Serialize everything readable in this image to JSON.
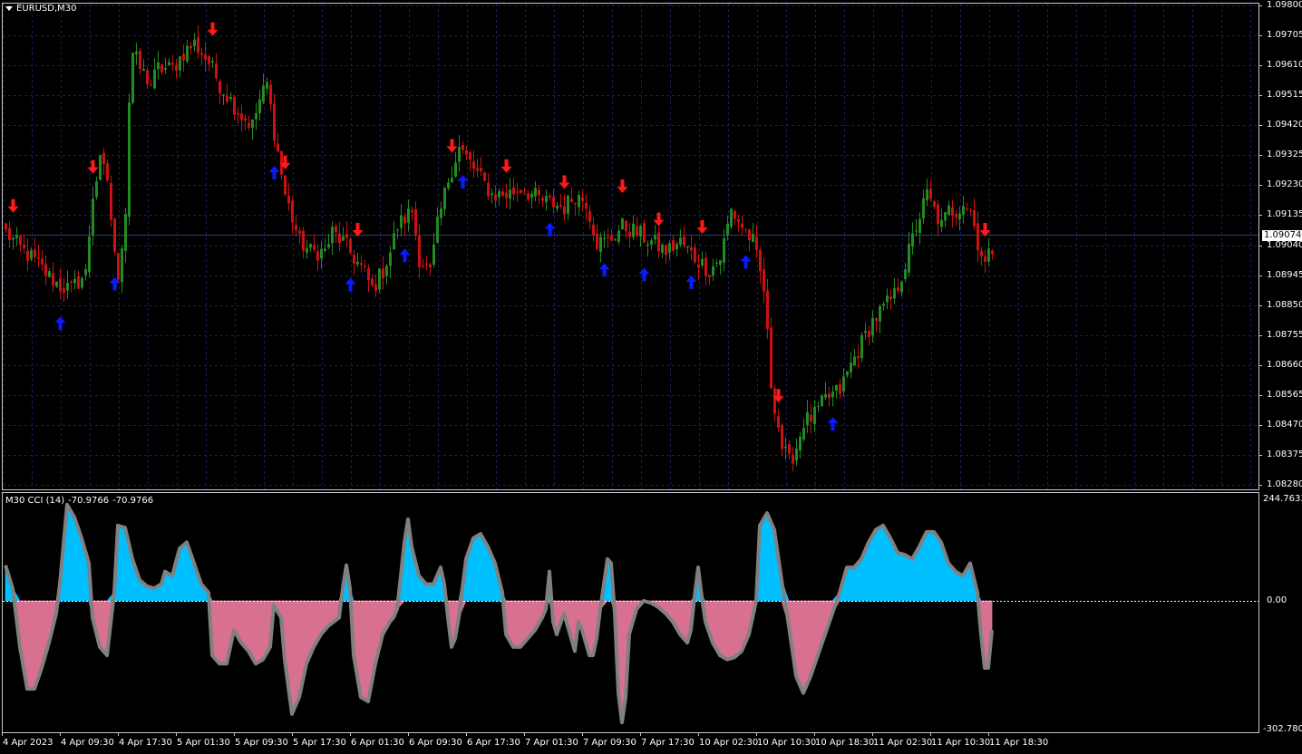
{
  "main_chart": {
    "symbol_timeframe": "EURUSD,M30",
    "price_axis": [
      "1.09800",
      "1.09705",
      "1.09610",
      "1.09515",
      "1.09420",
      "1.09325",
      "1.09230",
      "1.09135",
      "1.09040",
      "1.08945",
      "1.08850",
      "1.08755",
      "1.08660",
      "1.08565",
      "1.08470",
      "1.08375",
      "1.08280"
    ],
    "current_price": "1.09074",
    "colors": {
      "background": "#000000",
      "grid": "#1c1c5a",
      "bull_candle": "#228b22",
      "bear_candle": "#cc1111",
      "buy_arrow": "#0a1aff",
      "sell_arrow": "#ff1a1a",
      "current_price_line": "#2a3a8a"
    }
  },
  "indicator": {
    "name": "M30 CCI (14)",
    "value1": "-70.9766",
    "value2": "-70.9766",
    "axis_top": "244.7633",
    "axis_zero": "0.00",
    "axis_bottom": "-302.7802",
    "colors": {
      "positive_fill": "#00bfff",
      "negative_fill": "#d87090",
      "line": "#808080"
    }
  },
  "time_axis": [
    "4 Apr 2023",
    "4 Apr 09:30",
    "4 Apr 17:30",
    "5 Apr 01:30",
    "5 Apr 09:30",
    "5 Apr 17:30",
    "6 Apr 01:30",
    "6 Apr 09:30",
    "6 Apr 17:30",
    "7 Apr 01:30",
    "7 Apr 09:30",
    "7 Apr 17:30",
    "10 Apr 02:30",
    "10 Apr 10:30",
    "10 Apr 18:30",
    "11 Apr 02:30",
    "11 Apr 10:30",
    "11 Apr 18:30"
  ],
  "chart_data": [
    {
      "type": "candlestick",
      "title": "EURUSD,M30",
      "ylim": [
        1.0828,
        1.098
      ],
      "current_price": 1.09074,
      "close_path": [
        [
          0,
          1.0908
        ],
        [
          4,
          1.0903
        ],
        [
          8,
          1.0899
        ],
        [
          12,
          1.0894
        ],
        [
          15,
          1.0891
        ],
        [
          18,
          1.089
        ],
        [
          22,
          1.0895
        ],
        [
          24,
          1.092
        ],
        [
          26,
          1.093
        ],
        [
          28,
          1.0925
        ],
        [
          30,
          1.09
        ],
        [
          31,
          1.0895
        ],
        [
          33,
          1.0915
        ],
        [
          34,
          1.095
        ],
        [
          35,
          1.0965
        ],
        [
          37,
          1.096
        ],
        [
          40,
          1.0955
        ],
        [
          42,
          1.096
        ],
        [
          46,
          1.096
        ],
        [
          49,
          1.0965
        ],
        [
          52,
          1.0968
        ],
        [
          56,
          1.0962
        ],
        [
          59,
          1.0955
        ],
        [
          62,
          1.095
        ],
        [
          65,
          1.0945
        ],
        [
          68,
          1.0942
        ],
        [
          70,
          1.095
        ],
        [
          72,
          1.0955
        ],
        [
          74,
          1.094
        ],
        [
          77,
          1.092
        ],
        [
          81,
          1.0905
        ],
        [
          84,
          1.0902
        ],
        [
          88,
          1.0902
        ],
        [
          90,
          1.0908
        ],
        [
          93,
          1.0905
        ],
        [
          96,
          1.09
        ],
        [
          99,
          1.0895
        ],
        [
          101,
          1.089
        ],
        [
          104,
          1.0896
        ],
        [
          106,
          1.0902
        ],
        [
          108,
          1.091
        ],
        [
          112,
          1.0915
        ],
        [
          114,
          1.09
        ],
        [
          117,
          1.0895
        ],
        [
          119,
          1.091
        ],
        [
          122,
          1.0925
        ],
        [
          125,
          1.0935
        ],
        [
          128,
          1.093
        ],
        [
          131,
          1.0925
        ],
        [
          134,
          1.092
        ],
        [
          138,
          1.092
        ],
        [
          142,
          1.0922
        ],
        [
          145,
          1.092
        ],
        [
          148,
          1.0918
        ],
        [
          151,
          1.0917
        ],
        [
          154,
          1.0916
        ],
        [
          157,
          1.092
        ],
        [
          160,
          1.0918
        ],
        [
          163,
          1.0905
        ],
        [
          166,
          1.0905
        ],
        [
          170,
          1.091
        ],
        [
          174,
          1.0908
        ],
        [
          178,
          1.0905
        ],
        [
          182,
          1.0902
        ],
        [
          186,
          1.0905
        ],
        [
          190,
          1.09
        ],
        [
          194,
          1.0896
        ],
        [
          197,
          1.09
        ],
        [
          200,
          1.0915
        ],
        [
          203,
          1.091
        ],
        [
          206,
          1.0905
        ],
        [
          209,
          1.089
        ],
        [
          211,
          1.086
        ],
        [
          214,
          1.084
        ],
        [
          216,
          1.0835
        ],
        [
          218,
          1.084
        ],
        [
          220,
          1.0848
        ],
        [
          223,
          1.085
        ],
        [
          226,
          1.0855
        ],
        [
          230,
          1.0858
        ],
        [
          233,
          1.0866
        ],
        [
          236,
          1.0873
        ],
        [
          239,
          1.088
        ],
        [
          242,
          1.0884
        ],
        [
          245,
          1.0888
        ],
        [
          248,
          1.0898
        ],
        [
          251,
          1.091
        ],
        [
          254,
          1.092
        ],
        [
          256,
          1.0915
        ],
        [
          258,
          1.091
        ],
        [
          260,
          1.0915
        ],
        [
          262,
          1.0915
        ],
        [
          264,
          1.0918
        ],
        [
          266,
          1.0915
        ],
        [
          268,
          1.0905
        ],
        [
          270,
          1.0898
        ],
        [
          272,
          1.0903
        ]
      ],
      "buy_signals": [
        15,
        30,
        74,
        95,
        110,
        126,
        150,
        165,
        176,
        189,
        204,
        228
      ],
      "sell_signals": [
        2,
        24,
        57,
        77,
        97,
        123,
        138,
        154,
        170,
        180,
        192,
        213,
        270
      ]
    },
    {
      "type": "area",
      "title": "M30 CCI (14)",
      "ylim": [
        -302.7802,
        244.7633
      ],
      "last_value": -70.9766,
      "points": [
        [
          0,
          85
        ],
        [
          2,
          30
        ],
        [
          4,
          -110
        ],
        [
          6,
          -210
        ],
        [
          8,
          -210
        ],
        [
          10,
          -160
        ],
        [
          12,
          -100
        ],
        [
          14,
          -30
        ],
        [
          15,
          40
        ],
        [
          17,
          230
        ],
        [
          19,
          200
        ],
        [
          21,
          150
        ],
        [
          23,
          90
        ],
        [
          24,
          -40
        ],
        [
          26,
          -110
        ],
        [
          28,
          -130
        ],
        [
          30,
          20
        ],
        [
          31,
          180
        ],
        [
          33,
          175
        ],
        [
          35,
          100
        ],
        [
          37,
          50
        ],
        [
          39,
          35
        ],
        [
          41,
          30
        ],
        [
          43,
          40
        ],
        [
          44,
          70
        ],
        [
          46,
          60
        ],
        [
          48,
          125
        ],
        [
          50,
          140
        ],
        [
          52,
          90
        ],
        [
          54,
          40
        ],
        [
          56,
          20
        ],
        [
          57,
          -130
        ],
        [
          59,
          -150
        ],
        [
          61,
          -150
        ],
        [
          63,
          -70
        ],
        [
          65,
          -100
        ],
        [
          67,
          -120
        ],
        [
          69,
          -150
        ],
        [
          71,
          -140
        ],
        [
          73,
          -110
        ],
        [
          74,
          -10
        ],
        [
          76,
          -40
        ],
        [
          77,
          -140
        ],
        [
          79,
          -270
        ],
        [
          81,
          -230
        ],
        [
          83,
          -150
        ],
        [
          85,
          -110
        ],
        [
          87,
          -80
        ],
        [
          89,
          -60
        ],
        [
          92,
          -40
        ],
        [
          93,
          30
        ],
        [
          94,
          85
        ],
        [
          95,
          30
        ],
        [
          96,
          -130
        ],
        [
          98,
          -230
        ],
        [
          100,
          -240
        ],
        [
          102,
          -150
        ],
        [
          104,
          -80
        ],
        [
          106,
          -50
        ],
        [
          107,
          -40
        ],
        [
          108,
          -20
        ],
        [
          110,
          140
        ],
        [
          111,
          195
        ],
        [
          112,
          130
        ],
        [
          114,
          60
        ],
        [
          116,
          40
        ],
        [
          118,
          40
        ],
        [
          119,
          60
        ],
        [
          120,
          80
        ],
        [
          121,
          40
        ],
        [
          122,
          -40
        ],
        [
          123,
          -110
        ],
        [
          124,
          -90
        ],
        [
          125,
          -40
        ],
        [
          127,
          100
        ],
        [
          129,
          150
        ],
        [
          131,
          160
        ],
        [
          133,
          130
        ],
        [
          135,
          90
        ],
        [
          137,
          20
        ],
        [
          138,
          -80
        ],
        [
          140,
          -110
        ],
        [
          142,
          -110
        ],
        [
          144,
          -90
        ],
        [
          146,
          -70
        ],
        [
          148,
          -40
        ],
        [
          149,
          -20
        ],
        [
          150,
          70
        ],
        [
          151,
          -50
        ],
        [
          152,
          -80
        ],
        [
          154,
          -30
        ],
        [
          155,
          -60
        ],
        [
          156,
          -90
        ],
        [
          157,
          -120
        ],
        [
          158,
          -50
        ],
        [
          159,
          -70
        ],
        [
          160,
          -100
        ],
        [
          161,
          -130
        ],
        [
          162,
          -130
        ],
        [
          163,
          -90
        ],
        [
          164,
          -20
        ],
        [
          166,
          100
        ],
        [
          167,
          90
        ],
        [
          168,
          -30
        ],
        [
          169,
          -220
        ],
        [
          170,
          -290
        ],
        [
          171,
          -230
        ],
        [
          172,
          -80
        ],
        [
          174,
          -20
        ],
        [
          176,
          0
        ],
        [
          178,
          -5
        ],
        [
          180,
          -15
        ],
        [
          182,
          -30
        ],
        [
          184,
          -50
        ],
        [
          186,
          -80
        ],
        [
          188,
          -100
        ],
        [
          189,
          -70
        ],
        [
          190,
          10
        ],
        [
          191,
          80
        ],
        [
          192,
          10
        ],
        [
          193,
          -50
        ],
        [
          195,
          -100
        ],
        [
          197,
          -130
        ],
        [
          199,
          -140
        ],
        [
          201,
          -135
        ],
        [
          203,
          -120
        ],
        [
          205,
          -80
        ],
        [
          207,
          0
        ],
        [
          208,
          180
        ],
        [
          210,
          210
        ],
        [
          212,
          170
        ],
        [
          214,
          50
        ],
        [
          216,
          -60
        ],
        [
          218,
          -180
        ],
        [
          220,
          -220
        ],
        [
          222,
          -180
        ],
        [
          224,
          -130
        ],
        [
          226,
          -80
        ],
        [
          228,
          -30
        ],
        [
          230,
          20
        ],
        [
          232,
          80
        ],
        [
          234,
          80
        ],
        [
          236,
          100
        ],
        [
          238,
          140
        ],
        [
          240,
          170
        ],
        [
          242,
          180
        ],
        [
          244,
          150
        ],
        [
          246,
          115
        ],
        [
          248,
          110
        ],
        [
          250,
          100
        ],
        [
          252,
          130
        ],
        [
          254,
          165
        ],
        [
          256,
          165
        ],
        [
          258,
          140
        ],
        [
          260,
          90
        ],
        [
          262,
          70
        ],
        [
          264,
          60
        ],
        [
          266,
          90
        ],
        [
          268,
          20
        ],
        [
          269,
          -80
        ],
        [
          270,
          -160
        ],
        [
          271,
          -160
        ],
        [
          272,
          -70
        ]
      ]
    }
  ]
}
